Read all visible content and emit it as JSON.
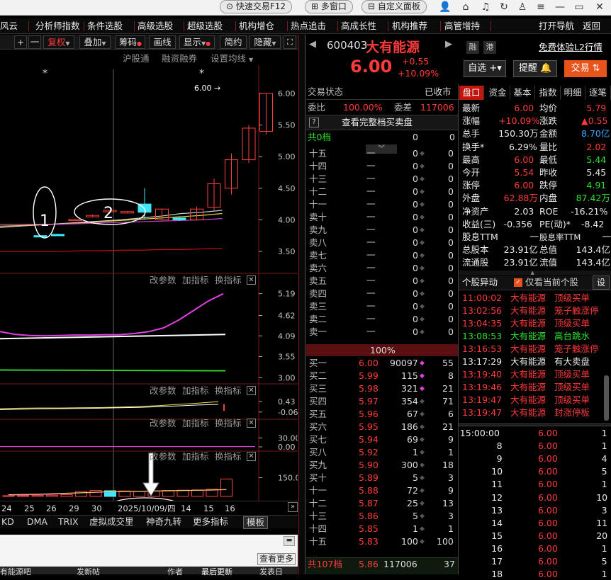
{
  "window": {
    "quick_trade": "快速交易F12",
    "multi_window": "多窗口",
    "custom_panel": "自定义面板"
  },
  "menu": [
    "风云",
    "分析师指数",
    "条件选股",
    "高级选股",
    "超级选股",
    "机构增仓",
    "热点追击",
    "高成长性",
    "机构推荐",
    "高管增持",
    "打开导航",
    "返回"
  ],
  "toolbar": {
    "plus": "+",
    "minus": "一",
    "fuquan": "复权",
    "overlay": "叠加",
    "chips": "筹码",
    "drawline": "画线",
    "display": "显示",
    "simple": "简约",
    "hide": "隐藏",
    "expand": "⛶"
  },
  "chart_header": {
    "hgt": "沪股通",
    "margin": "融资融券",
    "set_ma": "设置均线"
  },
  "price_chart": {
    "ylabels": [
      "6.00",
      "5.50",
      "5.00",
      "4.50",
      "4.00",
      "3.50"
    ],
    "yvalues": [
      6.0,
      5.5,
      5.0,
      4.5,
      4.0,
      3.5
    ],
    "ylim": [
      3.31,
      6.2
    ],
    "max_label": "6.00",
    "annotations": [
      "1",
      "2"
    ],
    "star": "*",
    "candles": [
      {
        "o": 3.75,
        "c": 3.75,
        "h": 3.75,
        "l": 3.75,
        "up": false
      },
      {
        "o": 3.77,
        "c": 3.77,
        "h": 3.78,
        "l": 3.76,
        "up": false
      },
      {
        "o": 4.01,
        "c": 4.01,
        "h": 4.02,
        "l": 4.0,
        "up": true
      },
      {
        "o": 4.06,
        "c": 4.07,
        "h": 4.08,
        "l": 4.05,
        "up": true
      },
      {
        "o": 4.15,
        "c": 4.15,
        "h": 4.15,
        "l": 4.15,
        "up": true
      },
      {
        "o": 4.13,
        "c": 4.13,
        "h": 4.14,
        "l": 4.12,
        "up": true
      },
      {
        "o": 4.12,
        "c": 4.25,
        "h": 4.5,
        "l": 4.0,
        "up": false
      },
      {
        "o": 4.0,
        "c": 4.17,
        "h": 4.18,
        "l": 3.98,
        "up": true
      },
      {
        "o": 4.0,
        "c": 4.03,
        "h": 4.05,
        "l": 3.98,
        "up": false
      },
      {
        "o": 4.0,
        "c": 4.17,
        "h": 4.21,
        "l": 3.99,
        "up": true
      },
      {
        "o": 4.2,
        "c": 4.57,
        "h": 4.65,
        "l": 4.15,
        "up": true
      },
      {
        "o": 4.5,
        "c": 4.95,
        "h": 5.05,
        "l": 4.4,
        "up": true
      },
      {
        "o": 4.95,
        "c": 5.45,
        "h": 5.5,
        "l": 4.9,
        "up": true
      },
      {
        "o": 5.4,
        "c": 6.0,
        "h": 6.0,
        "l": 5.35,
        "up": true
      }
    ]
  },
  "ind1": {
    "labels": [
      "改参数",
      "加指标",
      "换指标"
    ],
    "ylabels": [
      "5.19",
      "4.62",
      "4.09",
      "3.55",
      "3.00"
    ],
    "yvalues": [
      5.19,
      4.62,
      4.09,
      3.55,
      3.0
    ],
    "ylim": [
      2.95,
      5.35
    ]
  },
  "ind2": {
    "labels": [
      "改参数",
      "加指标",
      "换指标"
    ],
    "ylabels": [
      "0.43",
      "-0.06"
    ],
    "yvalues": [
      0.43,
      -0.06
    ],
    "ylim": [
      -0.2,
      0.6
    ]
  },
  "ind3": {
    "labels": [
      "改参数",
      "加指标",
      "换指标"
    ],
    "ylabels": [
      "30.00",
      "0.00"
    ],
    "yvalues": [
      30,
      0
    ],
    "ylim": [
      0,
      45
    ]
  },
  "ind4": {
    "labels": [
      "改参数",
      "加指标",
      "换指标"
    ],
    "ylabels": [
      "150.00"
    ],
    "yvalues": [
      150
    ],
    "ylim": [
      0,
      250
    ],
    "vols": [
      6,
      12,
      8,
      10,
      14,
      40,
      48,
      46,
      44,
      42,
      44,
      48,
      50,
      52,
      58,
      140
    ]
  },
  "dates": [
    "24",
    "25",
    "26",
    "29",
    "30",
    "2025/10/09/四",
    "14",
    "15",
    "16"
  ],
  "bottom_tabs": [
    "KD",
    "DMA",
    "TRIX",
    "虚拟成交里",
    "神奇九转",
    "更多指标",
    "模板"
  ],
  "bottom": {
    "view_more": "查看更多",
    "forum": "有能源吧",
    "post": "发新帖",
    "author": "作者",
    "latest": "最后更新",
    "post_date": "发表日"
  },
  "stock": {
    "code": "600403",
    "name": "大有能源",
    "price": "6.00",
    "change": "+0.55",
    "change_pct": "+10.09%",
    "rong": "融",
    "gang": "港",
    "promo": "免费体验L2行情",
    "watch": "自选",
    "remind": "提醒",
    "trade": "交易"
  },
  "order": {
    "status": "交易状态",
    "closed": "已收市",
    "webi": "委比",
    "webi_val": "100.00%",
    "weicha": "委差",
    "weicha_val": "117006",
    "view_full": "查看完整档买卖盘",
    "total_sell": "共0档",
    "zero": "0",
    "sell": [
      [
        "十五",
        "一",
        "0",
        "0"
      ],
      [
        "十四",
        "一",
        "0",
        "0"
      ],
      [
        "十三",
        "一",
        "0",
        "0"
      ],
      [
        "十二",
        "一",
        "0",
        "0"
      ],
      [
        "十一",
        "一",
        "0",
        "0"
      ],
      [
        "卖十",
        "一",
        "0",
        "0"
      ],
      [
        "卖九",
        "一",
        "0",
        "0"
      ],
      [
        "卖八",
        "一",
        "0",
        "0"
      ],
      [
        "卖七",
        "一",
        "0",
        "0"
      ],
      [
        "卖六",
        "一",
        "0",
        "0"
      ],
      [
        "卖五",
        "一",
        "0",
        "0"
      ],
      [
        "卖四",
        "一",
        "0",
        "0"
      ],
      [
        "卖三",
        "一",
        "0",
        "0"
      ],
      [
        "卖二",
        "一",
        "0",
        "0"
      ],
      [
        "卖一",
        "一",
        "0",
        "0"
      ]
    ],
    "pct": "100%",
    "buy": [
      [
        "买一",
        "6.00",
        "90097",
        "55"
      ],
      [
        "买二",
        "5.99",
        "115",
        "8"
      ],
      [
        "买三",
        "5.98",
        "321",
        "21"
      ],
      [
        "买四",
        "5.97",
        "354",
        "71"
      ],
      [
        "买五",
        "5.96",
        "67",
        "6"
      ],
      [
        "买六",
        "5.95",
        "186",
        "21"
      ],
      [
        "买七",
        "5.94",
        "69",
        "9"
      ],
      [
        "买八",
        "5.92",
        "1",
        "1"
      ],
      [
        "买九",
        "5.90",
        "300",
        "18"
      ],
      [
        "买十",
        "5.89",
        "5",
        "3"
      ],
      [
        "十一",
        "5.88",
        "72",
        "9"
      ],
      [
        "十二",
        "5.87",
        "25",
        "13"
      ],
      [
        "十三",
        "5.86",
        "5",
        "3"
      ],
      [
        "十四",
        "5.85",
        "1",
        "1"
      ],
      [
        "十五",
        "5.83",
        "100",
        "100"
      ]
    ],
    "total_buy": [
      "共107档",
      "5.86",
      "117006",
      "37"
    ]
  },
  "tabs": [
    "盘口",
    "资金",
    "基本",
    "指数",
    "明细",
    "逐笔"
  ],
  "quote": [
    [
      "最新",
      "6.00",
      "均价",
      "5.79"
    ],
    [
      "涨幅",
      "+10.09%",
      "涨跌",
      "▲0.55"
    ],
    [
      "总手",
      "150.30万",
      "金额",
      "8.70亿"
    ],
    [
      "换手*",
      "6.29%",
      "量比",
      "2.02"
    ],
    [
      "最高",
      "6.00",
      "最低",
      "5.44"
    ],
    [
      "今开",
      "5.54",
      "昨收",
      "5.45"
    ],
    [
      "涨停",
      "6.00",
      "跌停",
      "4.91"
    ],
    [
      "外盘",
      "62.88万",
      "内盘",
      "87.42万"
    ],
    [
      "净资产",
      "2.03",
      "ROE",
      "-16.21%"
    ],
    [
      "收益(三)",
      "-0.356",
      "PE(动)*",
      "-8.42"
    ],
    [
      "股息TTM",
      "一",
      "股息率TTM",
      "一"
    ],
    [
      "总股本",
      "23.91亿",
      "总值",
      "143.4亿"
    ],
    [
      "流通股",
      "23.91亿",
      "流值",
      "143.4亿"
    ]
  ],
  "anomaly": {
    "title": "个股异动",
    "only_current": "仅看当前个股",
    "settings": "设",
    "rows": [
      [
        "11:00:02",
        "大有能源",
        "顶级买单"
      ],
      [
        "13:02:56",
        "大有能源",
        "笼子触涨停"
      ],
      [
        "13:04:35",
        "大有能源",
        "顶级买单"
      ],
      [
        "13:08:53",
        "大有能源",
        "高台跳水"
      ],
      [
        "13:16:53",
        "大有能源",
        "笼子触涨停"
      ],
      [
        "13:17:29",
        "大有能源",
        "有大卖盘"
      ],
      [
        "13:19:40",
        "大有能源",
        "顶级买单"
      ],
      [
        "13:19:46",
        "大有能源",
        "顶级买单"
      ],
      [
        "13:19:47",
        "大有能源",
        "顶级买单"
      ],
      [
        "13:19:47",
        "大有能源",
        "封涨停板"
      ]
    ]
  },
  "ticks": [
    [
      "15:00:00",
      "6.00",
      "1"
    ],
    [
      "8",
      "6.00",
      "1"
    ],
    [
      "9",
      "6.00",
      "4"
    ],
    [
      "10",
      "6.00",
      "5"
    ],
    [
      "11",
      "6.00",
      "1"
    ],
    [
      "12",
      "6.00",
      "10"
    ],
    [
      "13",
      "6.00",
      "3"
    ],
    [
      "14",
      "6.00",
      "11"
    ],
    [
      "15",
      "6.00",
      "20"
    ],
    [
      "16",
      "6.00",
      "1"
    ],
    [
      "17",
      "6.00",
      "5"
    ],
    [
      "18",
      "6.00",
      "1"
    ]
  ]
}
